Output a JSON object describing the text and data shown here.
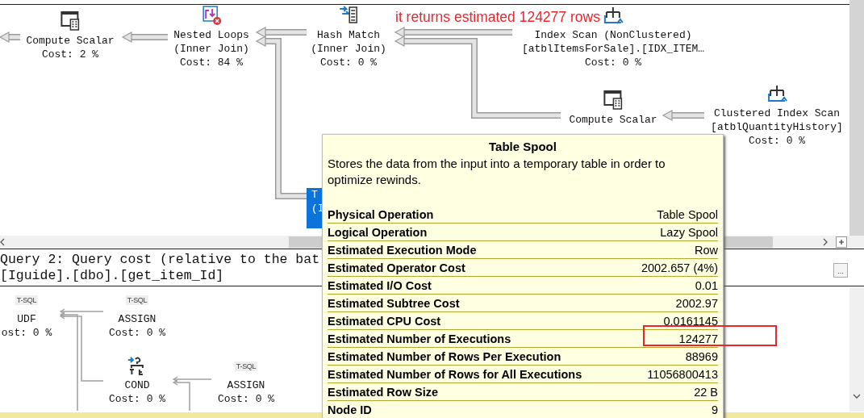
{
  "plan": {
    "annotation": "it returns estimated 124277 rows",
    "nodes": [
      {
        "kind": "compute_scalar",
        "lines": [
          "Compute Scalar",
          "Cost: 2 %"
        ],
        "selected": false
      },
      {
        "kind": "nested_loops",
        "lines": [
          "Nested Loops",
          "(Inner Join)",
          "Cost: 84 %"
        ],
        "selected": false
      },
      {
        "kind": "hash_match",
        "lines": [
          "Hash Match",
          "(Inner Join)",
          "Cost: 0 %"
        ],
        "selected": false
      },
      {
        "kind": "index_scan",
        "lines": [
          "Index Scan (NonClustered)",
          "[atblItemsForSale].[IDX_ITEM…",
          "Cost: 0 %"
        ],
        "selected": false
      },
      {
        "kind": "compute_scalar",
        "lines": [
          "Compute Scalar"
        ],
        "selected": false
      },
      {
        "kind": "clustered_index_scan",
        "lines": [
          "Clustered Index Scan",
          "[atblQuantityHistory]",
          "Cost: 0 %"
        ],
        "selected": false
      },
      {
        "kind": "table_spool",
        "lines": [
          "T",
          "(I"
        ],
        "selected": true
      }
    ]
  },
  "query2": {
    "header": "Query 2: Query cost (relative to the bat",
    "procedure": "[Iguide].[dbo].[get_item_Id]",
    "button": "...",
    "nodes": [
      {
        "kind": "tsql",
        "badge": "T-SQL",
        "lines": [
          "UDF",
          "ost: 0 %"
        ]
      },
      {
        "kind": "tsql",
        "badge": "T-SQL",
        "lines": [
          "ASSIGN",
          "Cost: 0 %"
        ]
      },
      {
        "kind": "cond",
        "lines": [
          "COND",
          "Cost: 0 %"
        ]
      },
      {
        "kind": "tsql",
        "badge": "T-SQL",
        "lines": [
          "ASSIGN",
          "Cost: 0 %"
        ]
      }
    ]
  },
  "tooltip": {
    "title": "Table Spool",
    "description": "Stores the data from the input into a temporary table in order to optimize rewinds.",
    "rows": [
      {
        "label": "Physical Operation",
        "value": "Table Spool",
        "highlighted": false
      },
      {
        "label": "Logical Operation",
        "value": "Lazy Spool",
        "highlighted": false
      },
      {
        "label": "Estimated Execution Mode",
        "value": "Row",
        "highlighted": false
      },
      {
        "label": "Estimated Operator Cost",
        "value": "2002.657 (4%)",
        "highlighted": false
      },
      {
        "label": "Estimated I/O Cost",
        "value": "0.01",
        "highlighted": false
      },
      {
        "label": "Estimated Subtree Cost",
        "value": "2002.97",
        "highlighted": false
      },
      {
        "label": "Estimated CPU Cost",
        "value": "0.0161145",
        "highlighted": false
      },
      {
        "label": "Estimated Number of Executions",
        "value": "124277",
        "highlighted": true
      },
      {
        "label": "Estimated Number of Rows Per Execution",
        "value": "88969",
        "highlighted": false
      },
      {
        "label": "Estimated Number of Rows for All Executions",
        "value": "11056800413",
        "highlighted": false
      },
      {
        "label": "Estimated Row Size",
        "value": "22 B",
        "highlighted": false
      },
      {
        "label": "Node ID",
        "value": "9",
        "highlighted": false
      }
    ]
  }
}
